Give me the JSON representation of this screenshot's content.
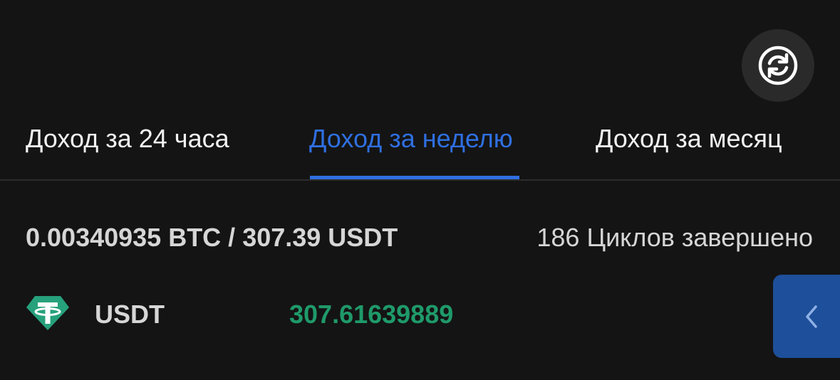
{
  "refresh": {
    "icon": "refresh-icon"
  },
  "tabs": [
    {
      "label": "Доход за 24 часа",
      "active": false
    },
    {
      "label": "Доход за неделю",
      "active": true
    },
    {
      "label": "Доход за месяц",
      "active": false
    }
  ],
  "summary": {
    "totals": "0.00340935 BTC / 307.39 USDT",
    "cycles": "186 Циклов завершено"
  },
  "coins": [
    {
      "icon": "tether-icon",
      "name": "USDT",
      "amount": "307.61639889"
    }
  ],
  "side_handle": {
    "icon": "chevron-left-icon"
  },
  "colors": {
    "background": "#141414",
    "accent": "#2f6fe0",
    "positive": "#1f9a6a",
    "tether": "#26a17b",
    "handle": "#1e4f9a"
  }
}
